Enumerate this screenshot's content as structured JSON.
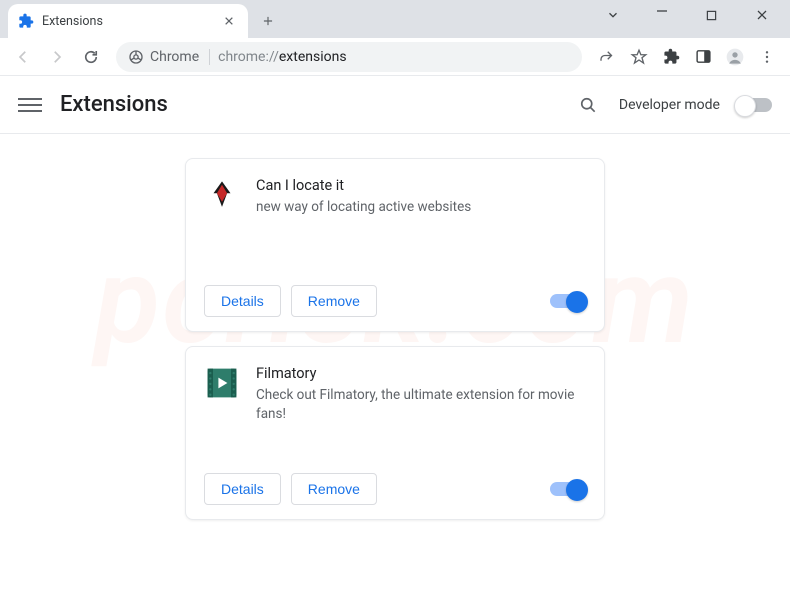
{
  "window": {
    "tab_title": "Extensions"
  },
  "omnibox": {
    "chip_label": "Chrome",
    "url_scheme": "chrome://",
    "url_path": "extensions"
  },
  "header": {
    "title": "Extensions",
    "developer_mode_label": "Developer mode",
    "developer_mode_on": false
  },
  "buttons": {
    "details": "Details",
    "remove": "Remove"
  },
  "extensions": [
    {
      "name": "Can I locate it",
      "description": "new way of locating active websites",
      "enabled": true,
      "icon": "phoenix"
    },
    {
      "name": "Filmatory",
      "description": "Check out Filmatory, the ultimate extension for movie fans!",
      "enabled": true,
      "icon": "film"
    }
  ],
  "watermark": "pcrisk.com"
}
